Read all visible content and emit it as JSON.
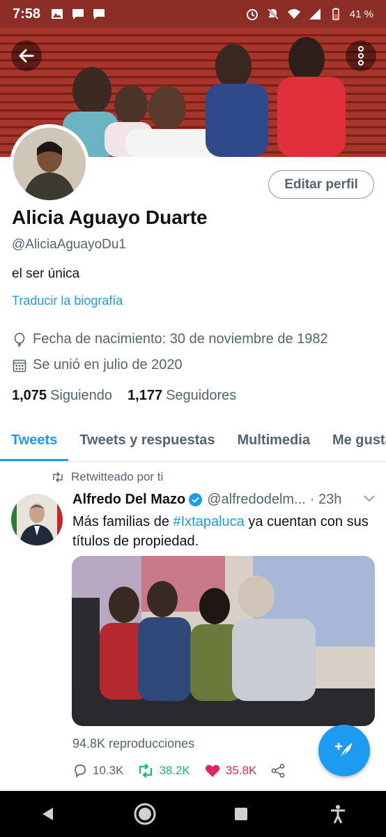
{
  "status_bar": {
    "time": "7:58",
    "battery": "41 %",
    "icons": [
      "image-icon",
      "message-icon",
      "message-icon",
      "alarm-icon",
      "mute-icon",
      "wifi-icon",
      "signal-icon",
      "battery-icon"
    ]
  },
  "profile": {
    "name": "Alicia Aguayo Duarte",
    "handle": "@AliciaAguayoDu1",
    "bio": "el ser única",
    "translate_label": "Traducir la biografía",
    "edit_label": "Editar perfil",
    "birth": "Fecha de nacimiento: 30 de noviembre de 1982",
    "joined": "Se unió en julio de 2020",
    "following_count": "1,075",
    "following_label": "Siguiendo",
    "followers_count": "1,177",
    "followers_label": "Seguidores"
  },
  "tabs": [
    {
      "label": "Tweets",
      "active": true
    },
    {
      "label": "Tweets y respuestas",
      "active": false
    },
    {
      "label": "Multimedia",
      "active": false
    },
    {
      "label": "Me gusta",
      "active": false
    }
  ],
  "tweet": {
    "retweet_label": "Retwitteado por ti",
    "author": "Alfredo Del Mazo",
    "handle": "@alfredodelm...",
    "time": "· 23h",
    "text_before": "Más familias de ",
    "hashtag": "#Ixtapaluca",
    "text_after": " ya cuentan con sus títulos de propiedad.",
    "views": "94.8K reproducciones",
    "replies": "10.3K",
    "retweets": "38.2K",
    "likes": "35.8K"
  },
  "colors": {
    "accent": "#1d9bf0",
    "retweet": "#17bf63",
    "like": "#e0245e",
    "status_bar": "#8c2d26"
  }
}
